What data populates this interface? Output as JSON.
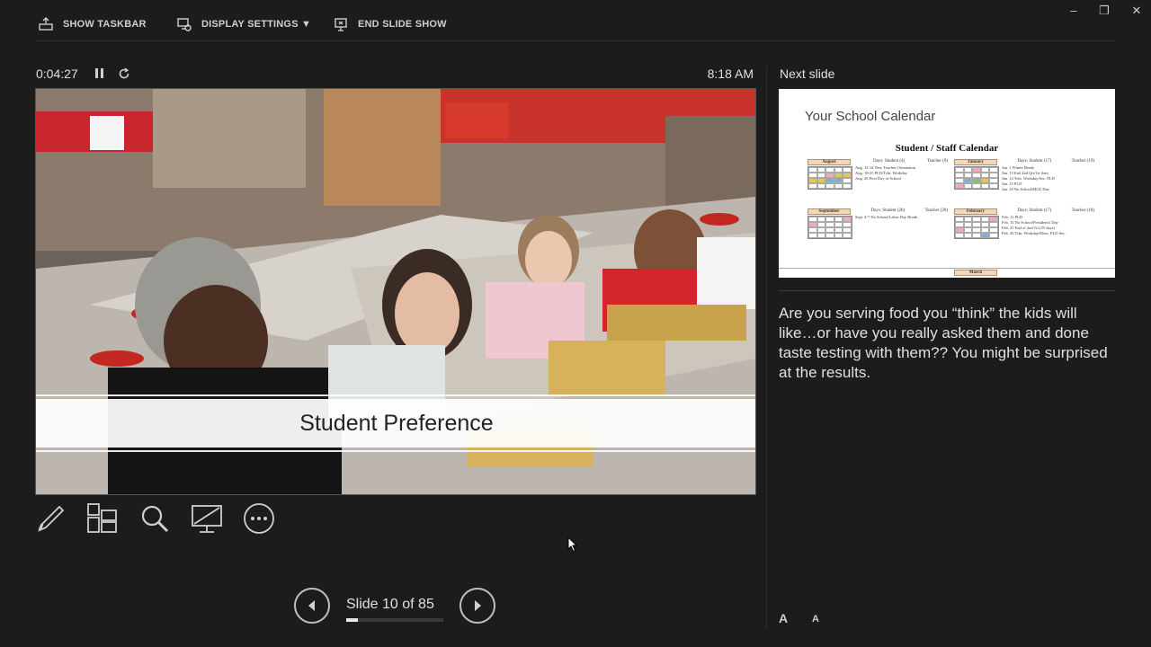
{
  "topbar": {
    "show_taskbar": "SHOW TASKBAR",
    "display_settings": "DISPLAY SETTINGS ▼",
    "end_slide_show": "END SLIDE SHOW",
    "window_minimize": "–",
    "window_restore": "❐",
    "window_close": "✕"
  },
  "status": {
    "elapsed": "0:04:27",
    "clock": "8:18 AM"
  },
  "slide": {
    "banner_text": "Student Preference"
  },
  "navigation": {
    "counter": "Slide 10 of 85",
    "current": 10,
    "total": 85,
    "progress_fraction": 0.118
  },
  "next_slide": {
    "label": "Next slide",
    "title": "Your School Calendar",
    "calendar_heading": "Student / Staff Calendar",
    "months": [
      {
        "name": "August",
        "days": "Days: Student (4)",
        "teacher": "Teacher (9)",
        "notes": [
          "Aug. 12-14   New Teacher Orientation",
          "Aug. 19-25   PLD/Tchr. Workday",
          "Aug. 26      First Day of School"
        ]
      },
      {
        "name": "January",
        "days": "Days: Student (17)",
        "teacher": "Teacher (19)",
        "notes": [
          "Jan. 1    Winter Break",
          "Jan. 13   End 2nd Qtr/1st Sem",
          "Jan. 14   Tchr. Workday/Sec. PLD",
          "Jan. 15   PLD",
          "Jan. 18   No School/MLK Day"
        ]
      },
      {
        "name": "September",
        "days": "Days: Student (20)",
        "teacher": "Teacher (20)",
        "notes": [
          "Sept. 4-7   No School/Labor Day Break"
        ]
      },
      {
        "name": "February",
        "days": "Days: Student (17)",
        "teacher": "Teacher (18)",
        "notes": [
          "Feb. 12   PLD",
          "Feb. 15   No School/President's Day",
          "Feb. 25   End of 2nd Tri (55 days)",
          "Feb. 26   Tchr. Workday/Elem. PLD Sec."
        ]
      }
    ],
    "next_month": "March"
  },
  "notes": {
    "text": "Are you serving food you “think” the kids will like…or have you really asked them and done taste testing with them?? You might be surprised at the results."
  },
  "notes_font": {
    "increase": "A",
    "decrease": "A"
  },
  "icons": [
    "toolbar-icon",
    "monitor-gear-icon",
    "end-show-icon",
    "pause-icon",
    "restart-icon",
    "pen-icon",
    "see-all-slides-icon",
    "zoom-icon",
    "black-screen-icon",
    "more-icon",
    "previous-icon",
    "next-icon",
    "cursor-icon"
  ],
  "colors": {
    "background": "#1c1c1c",
    "text": "#e0e0e0",
    "accent": "#cfcfcf"
  }
}
